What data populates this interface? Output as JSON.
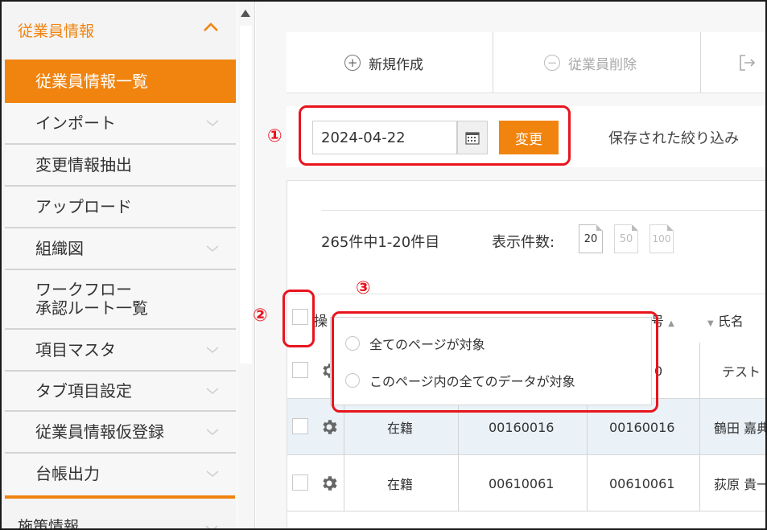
{
  "sidebar": {
    "section_title": "従業員情報",
    "items": [
      {
        "label": "従業員情報一覧"
      },
      {
        "label": "インポート"
      },
      {
        "label": "変更情報抽出"
      },
      {
        "label": "アップロード"
      },
      {
        "label": "組織図"
      },
      {
        "label": "ワークフロー\n承認ルート一覧"
      },
      {
        "label": "項目マスタ"
      },
      {
        "label": "タブ項目設定"
      },
      {
        "label": "従業員情報仮登録"
      },
      {
        "label": "台帳出力"
      }
    ],
    "next_section_title": "施策情報"
  },
  "toolbar": {
    "new_label": "新規作成",
    "delete_label": "従業員削除"
  },
  "filter": {
    "date_value": "2024-04-22",
    "change_label": "変更",
    "saved_filter_label": "保存された絞り込み"
  },
  "list": {
    "count_text": "265件中1-20件目",
    "per_page_label": "表示件数:",
    "page_sizes": [
      "20",
      "50",
      "100"
    ],
    "header": {
      "op": "操",
      "col3_partial": "号",
      "col4": "氏名"
    },
    "rows": [
      {
        "status": "",
        "code1": "",
        "code2": "0",
        "name": "テスト"
      },
      {
        "status": "在籍",
        "code1": "00160016",
        "code2": "00160016",
        "name": "鶴田 嘉典"
      },
      {
        "status": "在籍",
        "code1": "00610061",
        "code2": "00610061",
        "name": "荻原 貴一"
      }
    ]
  },
  "popup": {
    "options": [
      {
        "label": "全てのページが対象"
      },
      {
        "label": "このページ内の全てのデータが対象"
      }
    ]
  },
  "annotations": [
    "①",
    "②",
    "③"
  ],
  "colors": {
    "accent": "#f0840f",
    "annotation": "#e8141d",
    "row_alt": "#eaf1f7"
  }
}
